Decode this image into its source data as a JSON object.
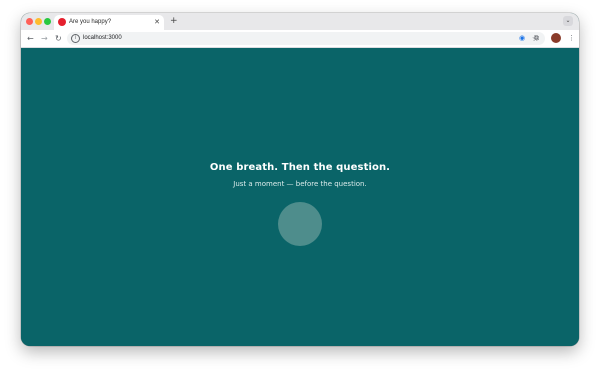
{
  "browser": {
    "tab": {
      "title": "Are you happy?",
      "close_glyph": "✕",
      "favicon": "red-circle-icon"
    },
    "new_tab_glyph": "+",
    "tabstrip_menu_glyph": "⌄",
    "nav": {
      "back": "←",
      "forward": "→",
      "reload": "↻"
    },
    "address": {
      "url": "localhost:3000",
      "site_info_glyph": "i"
    },
    "star_glyph": "☆",
    "extension_glyph": "◉",
    "extensions_menu_glyph": "⧉",
    "menu_glyph": "⋮"
  },
  "page": {
    "headline": "One breath. Then the question.",
    "subline": "Just a moment — before the question.",
    "colors": {
      "background": "#0a6468",
      "circle": "#4e8d8c",
      "text": "#ffffff"
    }
  }
}
